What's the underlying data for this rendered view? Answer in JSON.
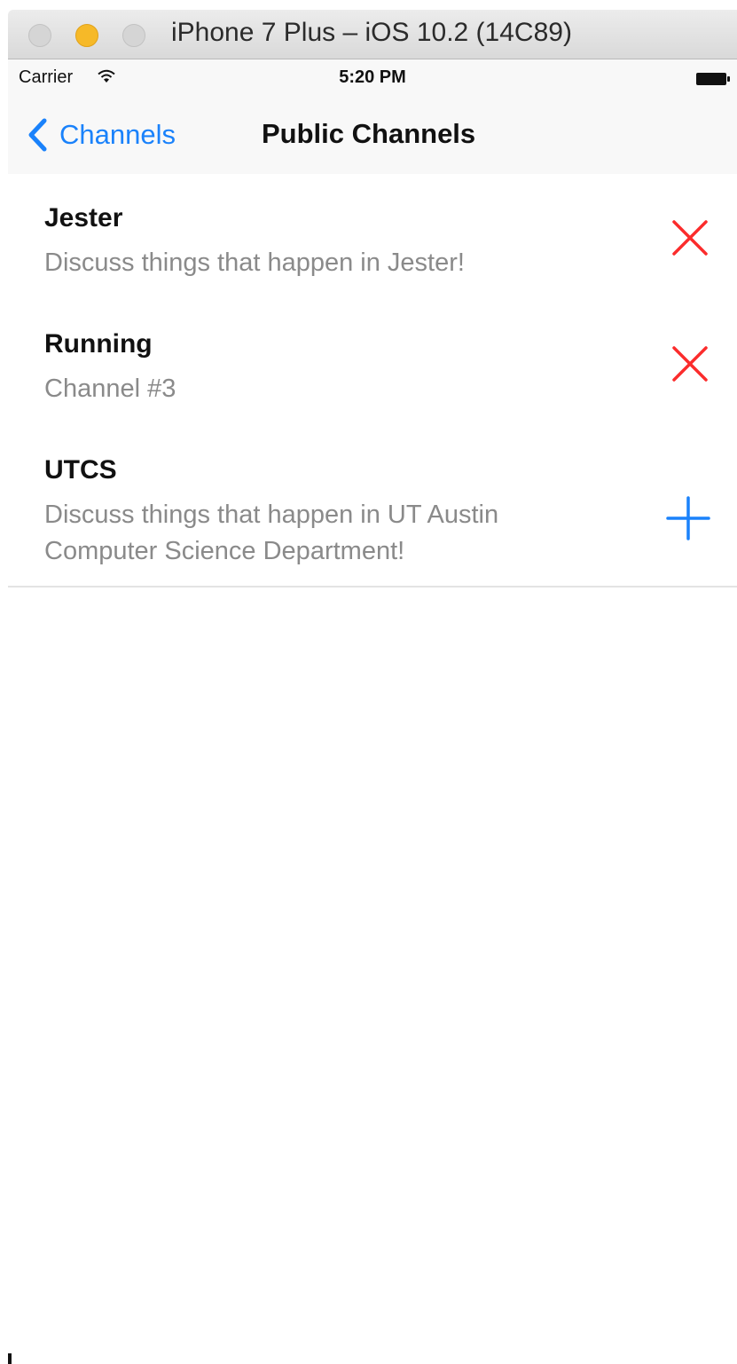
{
  "window": {
    "title": "iPhone 7 Plus – iOS 10.2 (14C89)"
  },
  "status_bar": {
    "carrier": "Carrier",
    "time": "5:20 PM",
    "wifi_icon": "wifi-icon",
    "battery_icon": "battery-icon"
  },
  "nav_bar": {
    "back_label": "Channels",
    "title": "Public Channels",
    "accent_color": "#1a82fb"
  },
  "channels": [
    {
      "name": "Jester",
      "description": "Discuss things that happen in Jester!",
      "action": "remove",
      "action_icon": "close-icon",
      "action_color": "#fb2c2c"
    },
    {
      "name": "Running",
      "description": "Channel #3",
      "action": "remove",
      "action_icon": "close-icon",
      "action_color": "#fb2c2c"
    },
    {
      "name": "UTCS",
      "description": "Discuss things that happen in UT Austin Computer Science Department!",
      "action": "add",
      "action_icon": "plus-icon",
      "action_color": "#1a82fb"
    }
  ]
}
